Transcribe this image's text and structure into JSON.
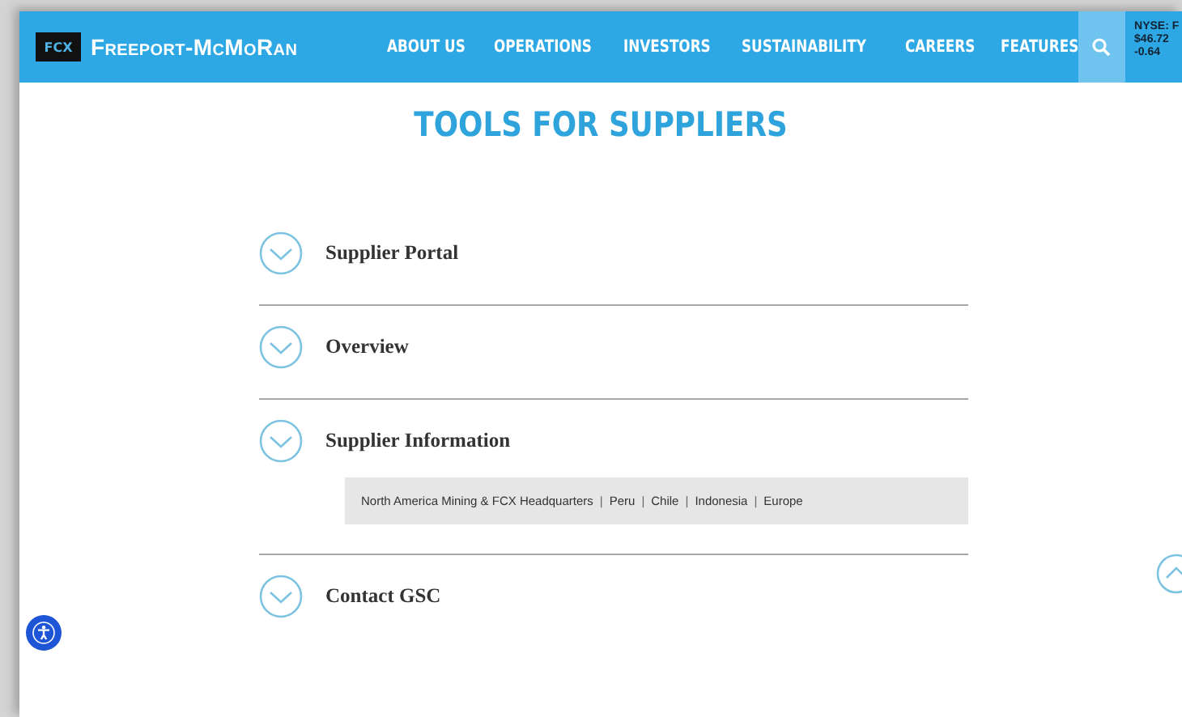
{
  "header": {
    "logo_text": "Freeport-McMoRan",
    "logo_mark": "FCX",
    "nav": [
      "ABOUT US",
      "OPERATIONS",
      "INVESTORS",
      "SUSTAINABILITY",
      "CAREERS",
      "FEATURES"
    ],
    "stock": {
      "exchange": "NYSE: F",
      "price": "$46.72",
      "change": "-0.64"
    }
  },
  "title": "TOOLS FOR SUPPLIERS",
  "accordion": [
    {
      "label": "Supplier Portal",
      "expanded": false
    },
    {
      "label": "Overview",
      "expanded": false
    },
    {
      "label": "Supplier Information",
      "expanded": true,
      "separator": "|",
      "links": [
        "North America Mining & FCX Headquarters",
        "Peru",
        "Chile",
        "Indonesia",
        "Europe"
      ]
    },
    {
      "label": "Contact GSC",
      "expanded": false
    }
  ]
}
